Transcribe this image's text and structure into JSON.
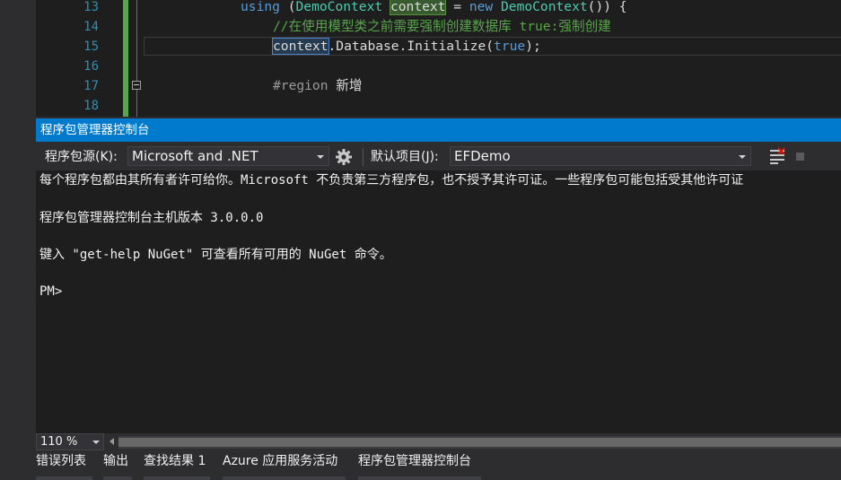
{
  "editor": {
    "line_numbers": [
      "13",
      "14",
      "15",
      "16",
      "17",
      "18"
    ],
    "lines": {
      "l13": {
        "kw_using": "using",
        "p1": " (",
        "type1": "DemoContext",
        "sp": " ",
        "var": "context",
        "p2": " = ",
        "kw_new": "new",
        "sp2": " ",
        "type2": "DemoContext",
        "p3": "()) {"
      },
      "l14": {
        "comment": "//在使用模型类之前需要强制创建数据库 true:强制创建"
      },
      "l15": {
        "var": "context",
        "rest1": ".Database.Initialize(",
        "kw_true": "true",
        "rest2": ");"
      },
      "l17": {
        "directive": "#region",
        "name": " 新增"
      }
    }
  },
  "console": {
    "title": "程序包管理器控制台",
    "toolbar": {
      "source_label": "程序包源(K):",
      "source_value": "Microsoft and .NET",
      "project_label": "默认项目(J):",
      "project_value": "EFDemo"
    },
    "output": [
      "每个程序包都由其所有者许可给你。Microsoft 不负责第三方程序包，也不授予其许可证。一些程序包可能包括受其他许可证",
      "程序包管理器控制台主机版本 3.0.0.0",
      "键入 \"get-help NuGet\" 可查看所有可用的 NuGet 命令。",
      "PM>"
    ],
    "zoom": "110 %"
  },
  "bottom_tabs": [
    "错误列表",
    "输出",
    "查找结果 1",
    "Azure 应用服务活动",
    "程序包管理器控制台"
  ],
  "icons": {
    "gear": "gear-icon",
    "clear": "clear-console-icon",
    "stop": "stop-icon",
    "fold": "collapse-region-icon"
  },
  "colors": {
    "accent": "#007acc",
    "keyword": "#569cd6",
    "type": "#4ec9b0",
    "comment": "#57a64a",
    "background": "#1e1e1e"
  }
}
